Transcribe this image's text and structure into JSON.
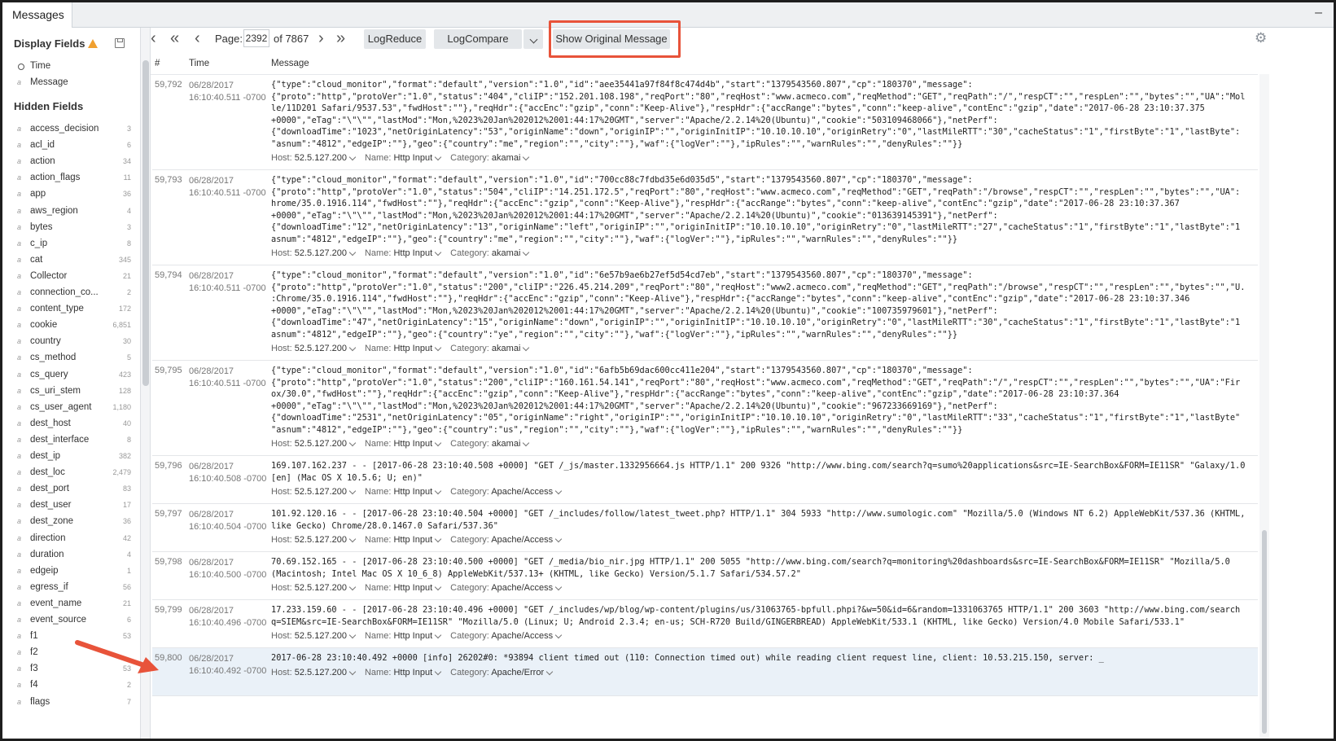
{
  "tab": {
    "label": "Messages",
    "minimize": "–"
  },
  "sidebar": {
    "display_fields_title": "Display Fields",
    "display_fields": [
      {
        "name": "Time",
        "type": "clock"
      },
      {
        "name": "Message",
        "type": "a"
      }
    ],
    "hidden_fields_title": "Hidden Fields",
    "hidden_fields": [
      {
        "name": "access_decision",
        "count": "3"
      },
      {
        "name": "acl_id",
        "count": "6"
      },
      {
        "name": "action",
        "count": "34"
      },
      {
        "name": "action_flags",
        "count": "11"
      },
      {
        "name": "app",
        "count": "36"
      },
      {
        "name": "aws_region",
        "count": "4"
      },
      {
        "name": "bytes",
        "count": "3"
      },
      {
        "name": "c_ip",
        "count": "8"
      },
      {
        "name": "cat",
        "count": "345"
      },
      {
        "name": "Collector",
        "count": "21"
      },
      {
        "name": "connection_co...",
        "count": "2"
      },
      {
        "name": "content_type",
        "count": "172"
      },
      {
        "name": "cookie",
        "count": "6,851"
      },
      {
        "name": "country",
        "count": "30"
      },
      {
        "name": "cs_method",
        "count": "5"
      },
      {
        "name": "cs_query",
        "count": "423"
      },
      {
        "name": "cs_uri_stem",
        "count": "128"
      },
      {
        "name": "cs_user_agent",
        "count": "1,180"
      },
      {
        "name": "dest_host",
        "count": "40"
      },
      {
        "name": "dest_interface",
        "count": "8"
      },
      {
        "name": "dest_ip",
        "count": "382"
      },
      {
        "name": "dest_loc",
        "count": "2,479"
      },
      {
        "name": "dest_port",
        "count": "83"
      },
      {
        "name": "dest_user",
        "count": "17"
      },
      {
        "name": "dest_zone",
        "count": "36"
      },
      {
        "name": "direction",
        "count": "42"
      },
      {
        "name": "duration",
        "count": "4"
      },
      {
        "name": "edgeip",
        "count": "1"
      },
      {
        "name": "egress_if",
        "count": "56"
      },
      {
        "name": "event_name",
        "count": "21"
      },
      {
        "name": "event_source",
        "count": "6"
      },
      {
        "name": "f1",
        "count": "53"
      },
      {
        "name": "f2",
        "count": ""
      },
      {
        "name": "f3",
        "count": "53"
      },
      {
        "name": "f4",
        "count": "2"
      },
      {
        "name": "flags",
        "count": "7"
      }
    ]
  },
  "toolbar": {
    "page_label": "Page:",
    "page_value": "2392",
    "page_total": "of 7867",
    "logreduce": "LogReduce",
    "logcompare": "LogCompare",
    "show_original": "Show Original Message"
  },
  "columns": {
    "num": "#",
    "time": "Time",
    "message": "Message"
  },
  "meta_labels": {
    "host": "Host:",
    "name": "Name:",
    "category": "Category:"
  },
  "messages": [
    {
      "num": "59,792",
      "date": "06/28/2017",
      "time": "16:10:40.511 -0700",
      "lines": [
        "{\"type\":\"cloud_monitor\",\"format\":\"default\",\"version\":\"1.0\",\"id\":\"aee35441a97f84f8c474d4b\",\"start\":\"1379543560.807\",\"cp\":\"180370\",\"message\":",
        "{\"proto\":\"http\",\"protoVer\":\"1.0\",\"status\":\"404\",\"cliIP\":\"152.201.108.198\",\"reqPort\":\"80\",\"reqHost\":\"www.acmeco.com\",\"reqMethod\":\"GET\",\"reqPath\":\"/\",\"respCT\":\"\",\"respLen\":\"\",\"bytes\":\"\",\"UA\":\"Mol",
        "le/11D201 Safari/9537.53\",\"fwdHost\":\"\"},\"reqHdr\":{\"accEnc\":\"gzip\",\"conn\":\"Keep-Alive\"},\"respHdr\":{\"accRange\":\"bytes\",\"conn\":\"keep-alive\",\"contEnc\":\"gzip\",\"date\":\"2017-06-28 23:10:37.375",
        "+0000\",\"eTag\":\"\\\"\\\"\",\"lastMod\":\"Mon,%2023%20Jan%202012%2001:44:17%20GMT\",\"server\":\"Apache/2.2.14%20(Ubuntu)\",\"cookie\":\"503109468066\"},\"netPerf\":",
        "{\"downloadTime\":\"1023\",\"netOriginLatency\":\"53\",\"originName\":\"down\",\"originIP\":\"\",\"originInitIP\":\"10.10.10.10\",\"originRetry\":\"0\",\"lastMileRTT\":\"30\",\"cacheStatus\":\"1\",\"firstByte\":\"1\",\"lastByte\":",
        "\"asnum\":\"4812\",\"edgeIP\":\"\"},\"geo\":{\"country\":\"me\",\"region\":\"\",\"city\":\"\"},\"waf\":{\"logVer\":\"\"},\"ipRules\":\"\",\"warnRules\":\"\",\"denyRules\":\"\"}}"
      ],
      "host": "52.5.127.200",
      "name": "Http Input",
      "category": "akamai"
    },
    {
      "num": "59,793",
      "date": "06/28/2017",
      "time": "16:10:40.511 -0700",
      "lines": [
        "{\"type\":\"cloud_monitor\",\"format\":\"default\",\"version\":\"1.0\",\"id\":\"700cc88c7fdbd35e6d035d5\",\"start\":\"1379543560.807\",\"cp\":\"180370\",\"message\":",
        "{\"proto\":\"http\",\"protoVer\":\"1.0\",\"status\":\"504\",\"cliIP\":\"14.251.172.5\",\"reqPort\":\"80\",\"reqHost\":\"www.acmeco.com\",\"reqMethod\":\"GET\",\"reqPath\":\"/browse\",\"respCT\":\"\",\"respLen\":\"\",\"bytes\":\"\",\"UA\":",
        "hrome/35.0.1916.114\",\"fwdHost\":\"\"},\"reqHdr\":{\"accEnc\":\"gzip\",\"conn\":\"Keep-Alive\"},\"respHdr\":{\"accRange\":\"bytes\",\"conn\":\"keep-alive\",\"contEnc\":\"gzip\",\"date\":\"2017-06-28 23:10:37.367",
        "+0000\",\"eTag\":\"\\\"\\\"\",\"lastMod\":\"Mon,%2023%20Jan%202012%2001:44:17%20GMT\",\"server\":\"Apache/2.2.14%20(Ubuntu)\",\"cookie\":\"013639145391\"},\"netPerf\":",
        "{\"downloadTime\":\"12\",\"netOriginLatency\":\"13\",\"originName\":\"left\",\"originIP\":\"\",\"originInitIP\":\"10.10.10.10\",\"originRetry\":\"0\",\"lastMileRTT\":\"27\",\"cacheStatus\":\"1\",\"firstByte\":\"1\",\"lastByte\":\"1",
        "asnum\":\"4812\",\"edgeIP\":\"\"},\"geo\":{\"country\":\"me\",\"region\":\"\",\"city\":\"\"},\"waf\":{\"logVer\":\"\"},\"ipRules\":\"\",\"warnRules\":\"\",\"denyRules\":\"\"}}"
      ],
      "host": "52.5.127.200",
      "name": "Http Input",
      "category": "akamai"
    },
    {
      "num": "59,794",
      "date": "06/28/2017",
      "time": "16:10:40.511 -0700",
      "lines": [
        "{\"type\":\"cloud_monitor\",\"format\":\"default\",\"version\":\"1.0\",\"id\":\"6e57b9ae6b27ef5d54cd7eb\",\"start\":\"1379543560.807\",\"cp\":\"180370\",\"message\":",
        "{\"proto\":\"http\",\"protoVer\":\"1.0\",\"status\":\"200\",\"cliIP\":\"226.45.214.209\",\"reqPort\":\"80\",\"reqHost\":\"www2.acmeco.com\",\"reqMethod\":\"GET\",\"reqPath\":\"/browse\",\"respCT\":\"\",\"respLen\":\"\",\"bytes\":\"\",\"U.",
        ":Chrome/35.0.1916.114\",\"fwdHost\":\"\"},\"reqHdr\":{\"accEnc\":\"gzip\",\"conn\":\"Keep-Alive\"},\"respHdr\":{\"accRange\":\"bytes\",\"conn\":\"keep-alive\",\"contEnc\":\"gzip\",\"date\":\"2017-06-28 23:10:37.346",
        "+0000\",\"eTag\":\"\\\"\\\"\",\"lastMod\":\"Mon,%2023%20Jan%202012%2001:44:17%20GMT\",\"server\":\"Apache/2.2.14%20(Ubuntu)\",\"cookie\":\"100735979601\"},\"netPerf\":",
        "{\"downloadTime\":\"47\",\"netOriginLatency\":\"15\",\"originName\":\"down\",\"originIP\":\"\",\"originInitIP\":\"10.10.10.10\",\"originRetry\":\"0\",\"lastMileRTT\":\"30\",\"cacheStatus\":\"1\",\"firstByte\":\"1\",\"lastByte\":\"1",
        "asnum\":\"4812\",\"edgeIP\":\"\"},\"geo\":{\"country\":\"ye\",\"region\":\"\",\"city\":\"\"},\"waf\":{\"logVer\":\"\"},\"ipRules\":\"\",\"warnRules\":\"\",\"denyRules\":\"\"}}"
      ],
      "host": "52.5.127.200",
      "name": "Http Input",
      "category": "akamai"
    },
    {
      "num": "59,795",
      "date": "06/28/2017",
      "time": "16:10:40.511 -0700",
      "lines": [
        "{\"type\":\"cloud_monitor\",\"format\":\"default\",\"version\":\"1.0\",\"id\":\"6afb5b69dac600cc411e204\",\"start\":\"1379543560.807\",\"cp\":\"180370\",\"message\":",
        "{\"proto\":\"http\",\"protoVer\":\"1.0\",\"status\":\"200\",\"cliIP\":\"160.161.54.141\",\"reqPort\":\"80\",\"reqHost\":\"www.acmeco.com\",\"reqMethod\":\"GET\",\"reqPath\":\"/\",\"respCT\":\"\",\"respLen\":\"\",\"bytes\":\"\",\"UA\":\"Fir",
        "ox/30.0\",\"fwdHost\":\"\"},\"reqHdr\":{\"accEnc\":\"gzip\",\"conn\":\"Keep-Alive\"},\"respHdr\":{\"accRange\":\"bytes\",\"conn\":\"keep-alive\",\"contEnc\":\"gzip\",\"date\":\"2017-06-28 23:10:37.364",
        "+0000\",\"eTag\":\"\\\"\\\"\",\"lastMod\":\"Mon,%2023%20Jan%202012%2001:44:17%20GMT\",\"server\":\"Apache/2.2.14%20(Ubuntu)\",\"cookie\":\"967233669169\"},\"netPerf\":",
        "{\"downloadTime\":\"2531\",\"netOriginLatency\":\"05\",\"originName\":\"right\",\"originIP\":\"\",\"originInitIP\":\"10.10.10.10\",\"originRetry\":\"0\",\"lastMileRTT\":\"33\",\"cacheStatus\":\"1\",\"firstByte\":\"1\",\"lastByte\"",
        "\"asnum\":\"4812\",\"edgeIP\":\"\"},\"geo\":{\"country\":\"us\",\"region\":\"\",\"city\":\"\"},\"waf\":{\"logVer\":\"\"},\"ipRules\":\"\",\"warnRules\":\"\",\"denyRules\":\"\"}}"
      ],
      "host": "52.5.127.200",
      "name": "Http Input",
      "category": "akamai"
    },
    {
      "num": "59,796",
      "date": "06/28/2017",
      "time": "16:10:40.508 -0700",
      "lines": [
        "169.107.162.237 - - [2017-06-28 23:10:40.508 +0000] \"GET /_js/master.1332956664.js HTTP/1.1\" 200 9326 \"http://www.bing.com/search?q=sumo%20applications&src=IE-SearchBox&FORM=IE11SR\" \"Galaxy/1.0",
        "[en] (Mac OS X 10.5.6; U; en)\""
      ],
      "host": "52.5.127.200",
      "name": "Http Input",
      "category": "Apache/Access"
    },
    {
      "num": "59,797",
      "date": "06/28/2017",
      "time": "16:10:40.504 -0700",
      "lines": [
        "101.92.120.16 - - [2017-06-28 23:10:40.504 +0000] \"GET /_includes/follow/latest_tweet.php? HTTP/1.1\" 304 5933 \"http://www.sumologic.com\" \"Mozilla/5.0 (Windows NT 6.2) AppleWebKit/537.36 (KHTML,",
        "like Gecko) Chrome/28.0.1467.0 Safari/537.36\""
      ],
      "host": "52.5.127.200",
      "name": "Http Input",
      "category": "Apache/Access"
    },
    {
      "num": "59,798",
      "date": "06/28/2017",
      "time": "16:10:40.500 -0700",
      "lines": [
        "70.69.152.165 - - [2017-06-28 23:10:40.500 +0000] \"GET /_media/bio_nir.jpg HTTP/1.1\" 200 5055 \"http://www.bing.com/search?q=monitoring%20dashboards&src=IE-SearchBox&FORM=IE11SR\" \"Mozilla/5.0",
        "(Macintosh; Intel Mac OS X 10_6_8) AppleWebKit/537.13+ (KHTML, like Gecko) Version/5.1.7 Safari/534.57.2\""
      ],
      "host": "52.5.127.200",
      "name": "Http Input",
      "category": "Apache/Access"
    },
    {
      "num": "59,799",
      "date": "06/28/2017",
      "time": "16:10:40.496 -0700",
      "lines": [
        "17.233.159.60 - - [2017-06-28 23:10:40.496 +0000] \"GET /_includes/wp/blog/wp-content/plugins/us/31063765-bpfull.phpi?&w=50&id=6&random=1331063765 HTTP/1.1\" 200 3603 \"http://www.bing.com/search",
        "q=SIEM&src=IE-SearchBox&FORM=IE11SR\" \"Mozilla/5.0 (Linux; U; Android 2.3.4; en-us; SCH-R720 Build/GINGERBREAD) AppleWebKit/533.1 (KHTML, like Gecko) Version/4.0 Mobile Safari/533.1\""
      ],
      "host": "52.5.127.200",
      "name": "Http Input",
      "category": "Apache/Access"
    },
    {
      "num": "59,800",
      "date": "06/28/2017",
      "time": "16:10:40.492 -0700",
      "lines": [
        "2017-06-28 23:10:40.492 +0000 [info] 26202#0: *93894 client timed out (110: Connection timed out) while reading client request line, client: 10.53.215.150, server: _"
      ],
      "host": "52.5.127.200",
      "name": "Http Input",
      "category": "Apache/Error"
    }
  ],
  "colors": {
    "highlight": "#e8533a",
    "selected_row": "#eaf1f8",
    "warning": "#f0a030"
  }
}
